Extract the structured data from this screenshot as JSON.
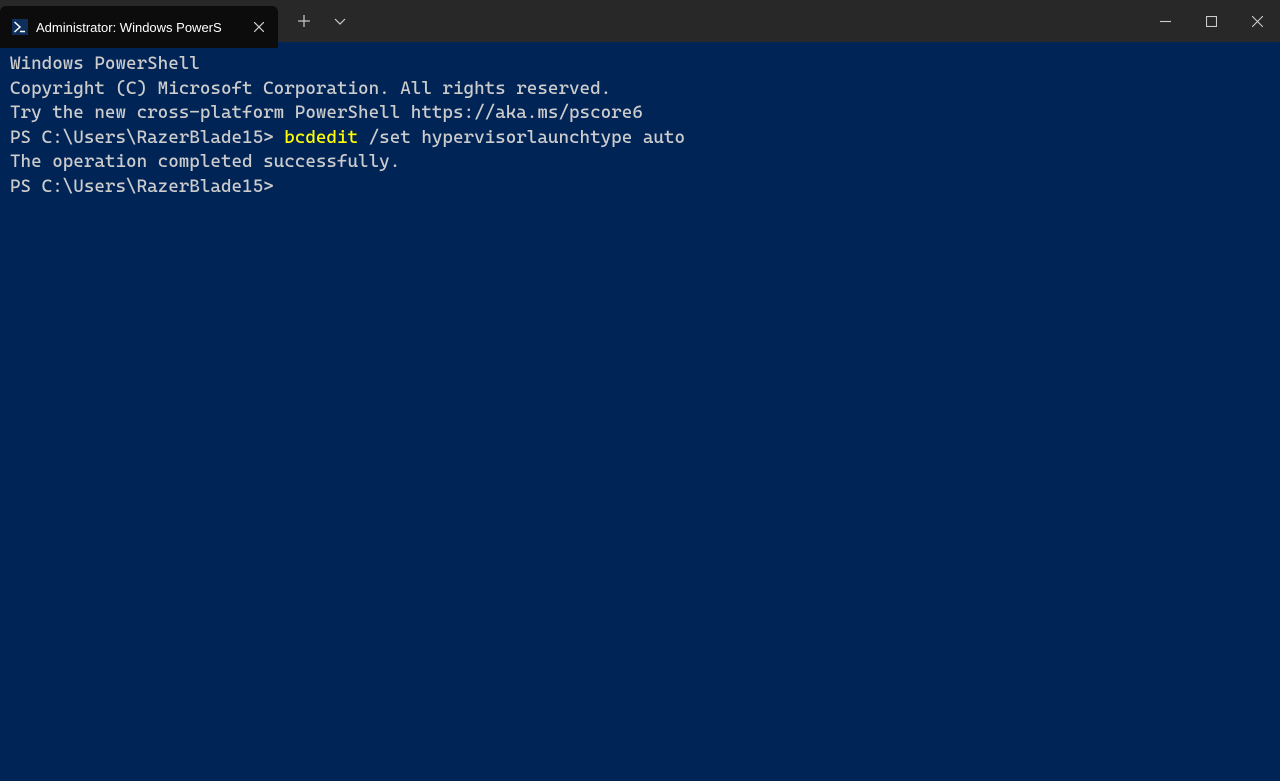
{
  "tab": {
    "title": "Administrator: Windows PowerS"
  },
  "terminal": {
    "line1": "Windows PowerShell",
    "line2": "Copyright (C) Microsoft Corporation. All rights reserved.",
    "line3": "",
    "line4": "Try the new cross-platform PowerShell https://aka.ms/pscore6",
    "line5": "",
    "prompt1": "PS C:\\Users\\RazerBlade15> ",
    "command_highlight": "bcdedit",
    "command_args": " /set hypervisorlaunchtype auto",
    "result": "The operation completed successfully.",
    "prompt2": "PS C:\\Users\\RazerBlade15>"
  }
}
